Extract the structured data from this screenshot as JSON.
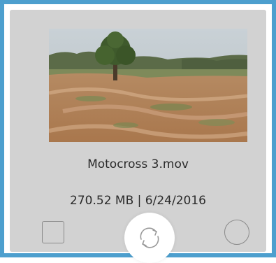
{
  "card": {
    "filename": "Motocross 3.mov",
    "size": "270.52 MB",
    "separator": "|",
    "date": "6/24/2016",
    "thumbnail_subject": "dirt motocross track with a tree",
    "selected": false
  },
  "icons": {
    "select": "checkbox-icon",
    "rotate": "refresh-rotate-icon",
    "option": "radio-circle-icon"
  },
  "colors": {
    "selection_border": "#4d9fce",
    "card_background": "#d2d2d2",
    "text": "#2b2b2b"
  }
}
